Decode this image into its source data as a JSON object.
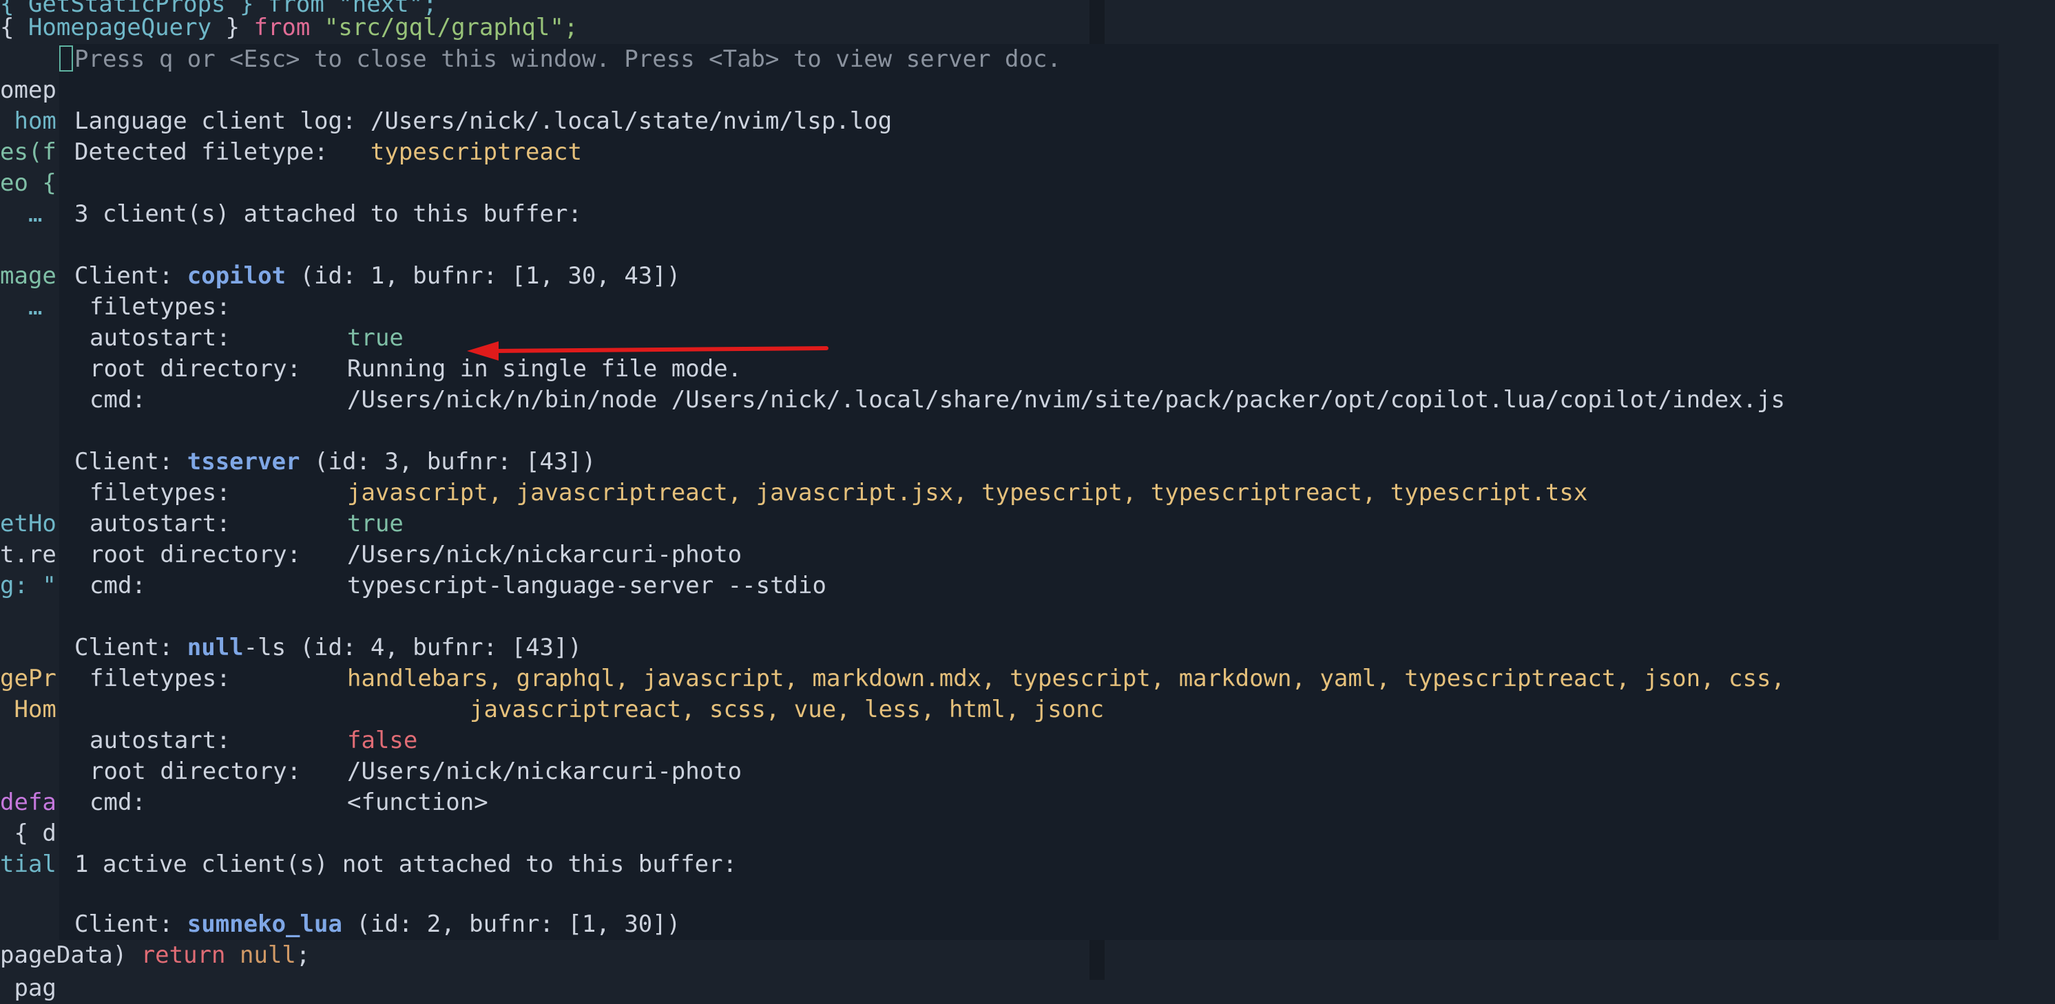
{
  "colors": {
    "editor_bg": "#1b222c",
    "float_bg": "#161d27",
    "yellow": "#e5c07b",
    "green": "#7fbfa6",
    "red": "#e06c75",
    "blue": "#7fa7e6",
    "arrow": "#e01b1b"
  },
  "editor": {
    "line_top_partial": "{ GetStaticProps } from \"next\";",
    "line_import_brace_open": "{ ",
    "line_import_name": "HomepageQuery",
    "line_import_brace_close": " } ",
    "line_import_from": "from",
    "line_import_path": " \"src/gql/graphql\";",
    "left_fragments": [
      "omep",
      " hom",
      "es(f",
      "eo {",
      "  …",
      "",
      "mage",
      "  …",
      "",
      "",
      "",
      "",
      "",
      "",
      "etHo",
      "t.re",
      "g: \"",
      "",
      "",
      "gePr",
      " Hom",
      "",
      "",
      "defa",
      " { d",
      "tial",
      "",
      "",
      "",
      " pag"
    ],
    "bottom_line_prefix": "pageData) ",
    "bottom_line_keyword": "return",
    "bottom_line_null": " null",
    "bottom_line_end": ";"
  },
  "lspinfo": {
    "header": "Press q or <Esc> to close this window. Press <Tab> to view server doc.",
    "log_label": "Language client log: ",
    "log_path": "/Users/nick/.local/state/nvim/lsp.log",
    "filetype_label": "Detected filetype:   ",
    "filetype_value": "typescriptreact",
    "attached_summary": "3 client(s) attached to this buffer:",
    "client_prefix": "Client: ",
    "labels": {
      "filetypes": "filetypes:",
      "autostart": "autostart:",
      "root": "root directory:",
      "cmd": "cmd:"
    },
    "clients": [
      {
        "name": "copilot",
        "name_suffix": "",
        "meta": " (id: 1, bufnr: [1, 30, 43])",
        "filetypes_line1": "",
        "filetypes_line2": "",
        "autostart": "true",
        "root": "Running in single file mode.",
        "cmd": "/Users/nick/n/bin/node /Users/nick/.local/share/nvim/site/pack/packer/opt/copilot.lua/copilot/index.js"
      },
      {
        "name": "tsserver",
        "name_suffix": "",
        "meta": " (id: 3, bufnr: [43])",
        "filetypes_line1": "javascript, javascriptreact, javascript.jsx, typescript, typescriptreact, typescript.tsx",
        "filetypes_line2": "",
        "autostart": "true",
        "root": "/Users/nick/nickarcuri-photo",
        "cmd": "typescript-language-server --stdio"
      },
      {
        "name": "null",
        "name_suffix": "-ls",
        "meta": " (id: 4, bufnr: [43])",
        "filetypes_line1": "handlebars, graphql, javascript, markdown.mdx, typescript, markdown, yaml, typescriptreact, json, css,",
        "filetypes_line2": "javascriptreact, scss, vue, less, html, jsonc",
        "autostart": "false",
        "root": "/Users/nick/nickarcuri-photo",
        "cmd": "<function>"
      }
    ],
    "not_attached_summary": "1 active client(s) not attached to this buffer:",
    "other_client": {
      "name": "sumneko_lua",
      "meta": " (id: 2, bufnr: [1, 30])"
    }
  }
}
